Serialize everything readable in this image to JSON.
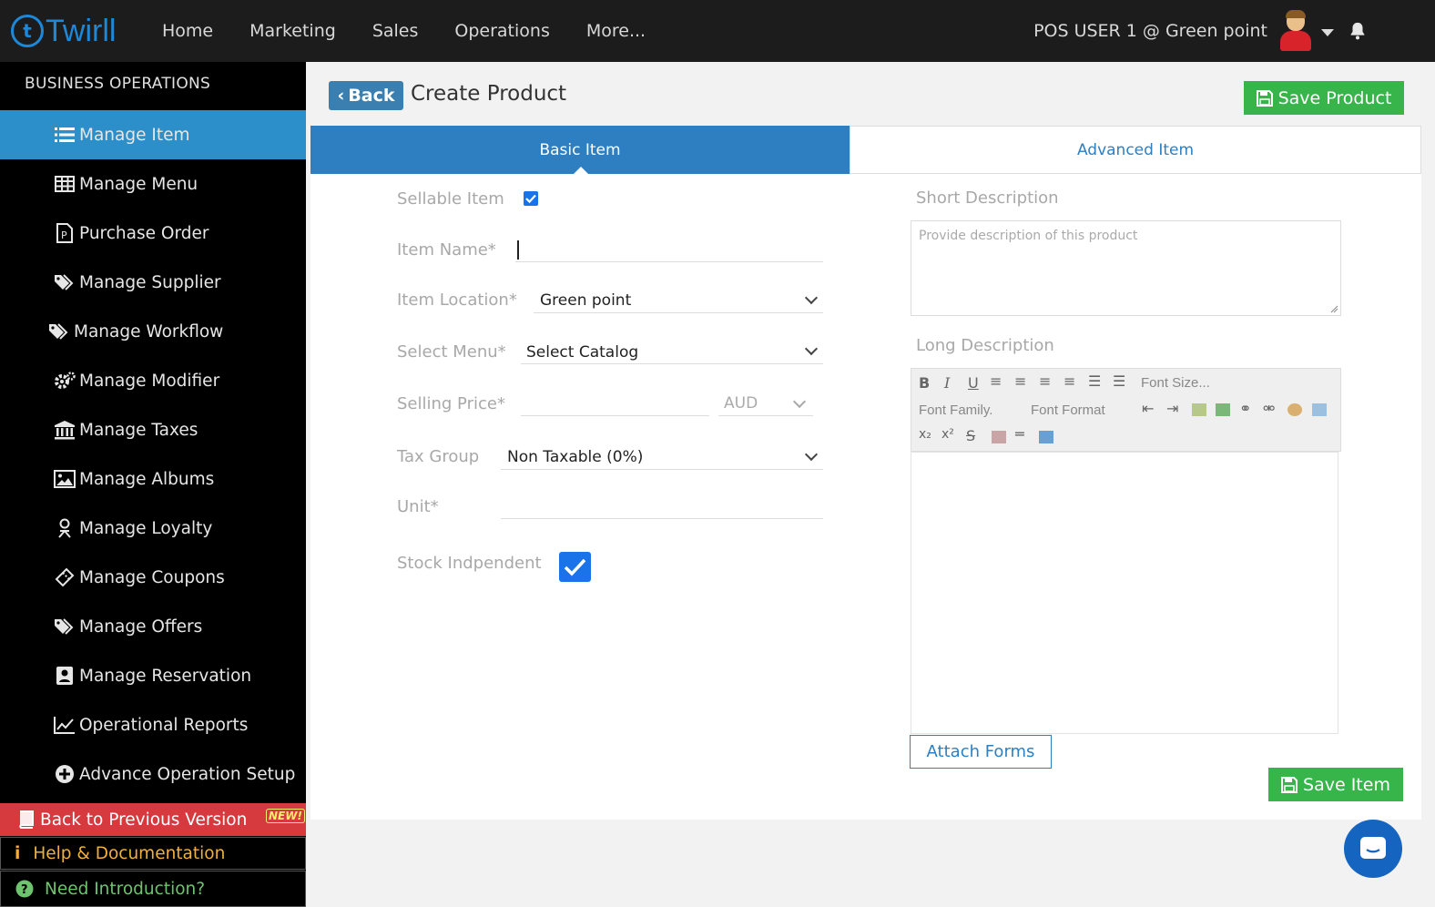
{
  "app": {
    "logo_text": "Twirll",
    "logo_mark": "t",
    "nav": [
      "Home",
      "Marketing",
      "Sales",
      "Operations",
      "More..."
    ],
    "user_label": "POS USER 1 @ Green point"
  },
  "sidebar": {
    "title": "BUSINESS OPERATIONS",
    "items": [
      {
        "label": "Manage Item",
        "icon": "list-icon"
      },
      {
        "label": "Manage Menu",
        "icon": "table-icon"
      },
      {
        "label": "Purchase Order",
        "icon": "document-p-icon"
      },
      {
        "label": "Manage Supplier",
        "icon": "tags-icon"
      },
      {
        "label": "Manage Workflow",
        "icon": "tags-icon"
      },
      {
        "label": "Manage Modifier",
        "icon": "gears-icon"
      },
      {
        "label": "Manage Taxes",
        "icon": "bank-icon"
      },
      {
        "label": "Manage Albums",
        "icon": "image-icon"
      },
      {
        "label": "Manage Loyalty",
        "icon": "person-icon"
      },
      {
        "label": "Manage Coupons",
        "icon": "ticket-icon"
      },
      {
        "label": "Manage Offers",
        "icon": "tags-icon"
      },
      {
        "label": "Manage Reservation",
        "icon": "contact-icon"
      },
      {
        "label": "Operational Reports",
        "icon": "line-chart-icon"
      },
      {
        "label": "Advance Operation Setup",
        "icon": "plus-circle-icon"
      }
    ],
    "back_prev": "Back to Previous Version",
    "new_badge": "NEW!",
    "help": "Help & Documentation",
    "intro": "Need Introduction?",
    "colors": {
      "active": "#2d8fc9",
      "back": "#d63a3e",
      "help": "#f0b03a",
      "intro": "#6ec36e"
    }
  },
  "header": {
    "back_label": "Back",
    "title": "Create Product",
    "save_product": "Save Product"
  },
  "tabs": {
    "basic": "Basic Item",
    "advanced": "Advanced Item"
  },
  "form": {
    "sellable_label": "Sellable Item",
    "sellable_checked": true,
    "item_name_label": "Item Name*",
    "item_name_value": "",
    "location_label": "Item Location*",
    "location_value": "Green point",
    "menu_label": "Select Menu*",
    "menu_value": "Select Catalog",
    "price_label": "Selling Price*",
    "currency": "AUD",
    "tax_label": "Tax Group",
    "tax_value": "Non Taxable (0%)",
    "unit_label": "Unit*",
    "stock_label": "Stock Indpendent",
    "stock_checked": true
  },
  "right": {
    "short_label": "Short Description",
    "short_placeholder": "Provide description of this product",
    "long_label": "Long Description",
    "font_size": "Font Size...",
    "font_family": "Font Family.",
    "font_format": "Font Format",
    "attach": "Attach Forms",
    "save_item": "Save Item"
  },
  "colors": {
    "primary": "#2d7fc1",
    "success": "#38b54a",
    "topbar": "#1c1c1c"
  }
}
